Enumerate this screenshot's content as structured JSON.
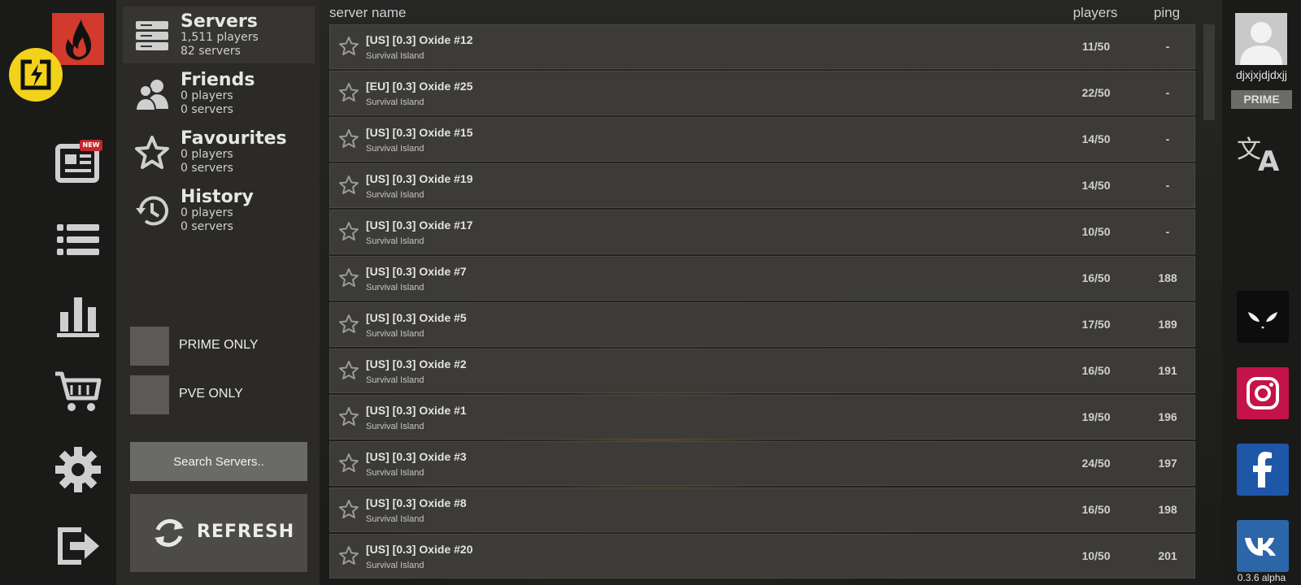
{
  "categories": {
    "servers": {
      "title": "Servers",
      "players": "1,511 players",
      "servers": "82 servers"
    },
    "friends": {
      "title": "Friends",
      "players": "0 players",
      "servers": "0 servers"
    },
    "favourites": {
      "title": "Favourites",
      "players": "0 players",
      "servers": "0 servers"
    },
    "history": {
      "title": "History",
      "players": "0 players",
      "servers": "0 servers"
    }
  },
  "filters": {
    "prime_only": "PRIME ONLY",
    "pve_only": "PVE ONLY"
  },
  "search": {
    "placeholder": "Search Servers.."
  },
  "refresh_label": "REFRESH",
  "news_badge": "NEW",
  "list_header": {
    "name": "server name",
    "players": "players",
    "ping": "ping"
  },
  "servers": [
    {
      "name": "[US] [0.3] Oxide #12",
      "map": "Survival Island",
      "players": "11/50",
      "ping": "-"
    },
    {
      "name": "[EU] [0.3] Oxide #25",
      "map": "Survival Island",
      "players": "22/50",
      "ping": "-"
    },
    {
      "name": "[US] [0.3] Oxide #15",
      "map": "Survival Island",
      "players": "14/50",
      "ping": "-"
    },
    {
      "name": "[US] [0.3] Oxide #19",
      "map": "Survival Island",
      "players": "14/50",
      "ping": "-"
    },
    {
      "name": "[US] [0.3] Oxide #17",
      "map": "Survival Island",
      "players": "10/50",
      "ping": "-"
    },
    {
      "name": "[US] [0.3] Oxide #7",
      "map": "Survival Island",
      "players": "16/50",
      "ping": "188"
    },
    {
      "name": "[US] [0.3] Oxide #5",
      "map": "Survival Island",
      "players": "17/50",
      "ping": "189"
    },
    {
      "name": "[US] [0.3] Oxide #2",
      "map": "Survival Island",
      "players": "16/50",
      "ping": "191"
    },
    {
      "name": "[US] [0.3] Oxide #1",
      "map": "Survival Island",
      "players": "19/50",
      "ping": "196"
    },
    {
      "name": "[US] [0.3] Oxide #3",
      "map": "Survival Island",
      "players": "24/50",
      "ping": "197"
    },
    {
      "name": "[US] [0.3] Oxide #8",
      "map": "Survival Island",
      "players": "16/50",
      "ping": "198"
    },
    {
      "name": "[US] [0.3] Oxide #20",
      "map": "Survival Island",
      "players": "10/50",
      "ping": "201"
    }
  ],
  "user": {
    "name": "djxjxjdjdxjj",
    "badge": "PRIME"
  },
  "version": "0.3.6 alpha",
  "colors": {
    "accent_red": "#d13a2c",
    "badge_yellow": "#f2d21b",
    "instagram": "#c4124a",
    "facebook": "#1f57a8",
    "vk": "#2d66a8",
    "row_bg": "#3c3b38"
  },
  "icons": {
    "rail": [
      "fire-logo",
      "plugin-badge-icon",
      "news-icon",
      "server-list-icon",
      "stats-icon",
      "shop-cart-icon",
      "settings-gear-icon",
      "logout-icon"
    ],
    "social": [
      "alien-eyes-icon",
      "instagram-icon",
      "facebook-icon",
      "vk-icon"
    ]
  }
}
